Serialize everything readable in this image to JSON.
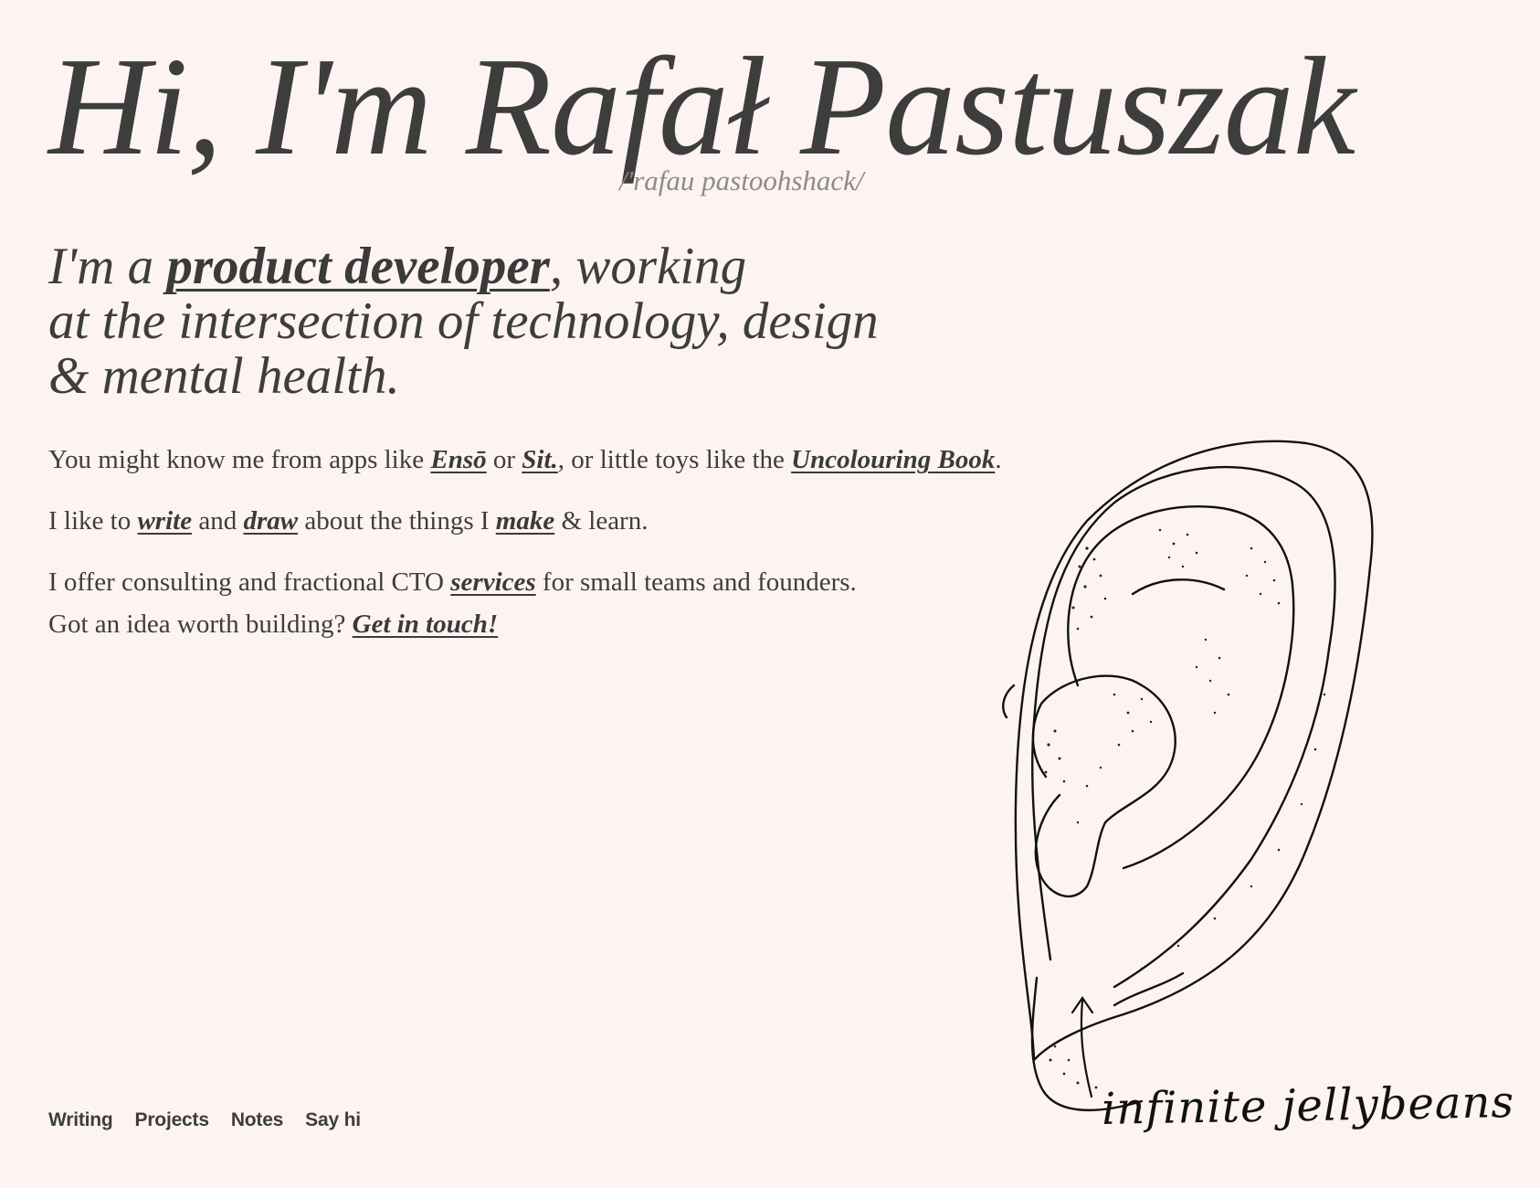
{
  "hero": {
    "headline": "Hi, I'm Rafał Pastuszak",
    "pronunciation": "/'rafau pastoohshack/"
  },
  "tagline": {
    "prefix": "I'm a ",
    "link": "product developer",
    "line1_suffix": ", working",
    "line2": "at the intersection of technology, design",
    "line3": "& mental health."
  },
  "bio": {
    "p1": {
      "t1": "You might know me from apps like ",
      "link_enso": "Ensō",
      "t2": " or ",
      "link_sit": "Sit.",
      "t3": ", or little toys like the ",
      "link_book": "Uncolouring Book",
      "t4": "."
    },
    "p2": {
      "t1": "I like to ",
      "link_write": "write",
      "t2": " and ",
      "link_draw": "draw",
      "t3": " about the things I ",
      "link_make": "make",
      "t4": " & learn."
    },
    "p3": {
      "t1": "I offer consulting and fractional CTO ",
      "link_services": "services",
      "t2": " for small teams and founders.",
      "t3": "Got an idea worth building? ",
      "link_contact": "Get in touch!"
    }
  },
  "footer_nav": [
    "Writing",
    "Projects",
    "Notes",
    "Say hi"
  ],
  "illustration": {
    "icon": "ear-drawing",
    "caption": "infinite jellybeans"
  },
  "colors": {
    "background": "#fdf4f2",
    "text": "#3d3d3d",
    "muted": "#8e8a89"
  }
}
